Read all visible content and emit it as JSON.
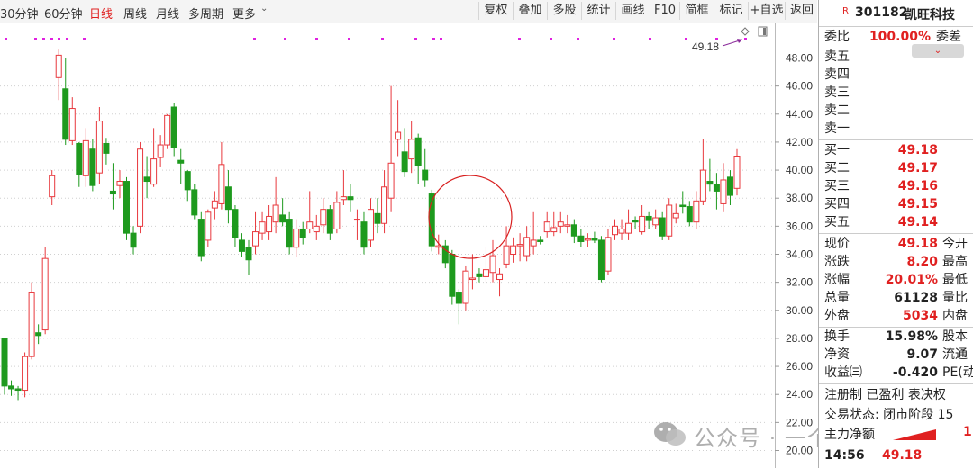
{
  "toolbar": {
    "periods": [
      "30分钟",
      "60分钟",
      "日线",
      "周线",
      "月线",
      "多周期",
      "更多"
    ],
    "active_period": "日线",
    "buttons": [
      "复权",
      "叠加",
      "多股",
      "统计",
      "画线",
      "F10",
      "简框",
      "标记",
      "+自选",
      "返回"
    ]
  },
  "chart_data": {
    "type": "candlestick",
    "y_ticks": [
      "48.00",
      "46.00",
      "44.00",
      "42.00",
      "40.00",
      "38.00",
      "36.00",
      "34.00",
      "32.00",
      "30.00",
      "28.00",
      "26.00",
      "24.00",
      "22.00",
      "20.00"
    ],
    "ylim": [
      19.5,
      49.5
    ],
    "up_color": "#e8383d",
    "down_color": "#1e9a1e",
    "last_price_marker": "49.18",
    "candles": [
      {
        "o": 28.0,
        "c": 24.6,
        "h": 28.0,
        "l": 24.0
      },
      {
        "o": 24.6,
        "c": 24.4,
        "h": 25.0,
        "l": 23.9
      },
      {
        "o": 24.4,
        "c": 24.3,
        "h": 24.6,
        "l": 23.6
      },
      {
        "o": 24.3,
        "c": 26.7,
        "h": 27.0,
        "l": 23.8
      },
      {
        "o": 26.7,
        "c": 31.3,
        "h": 32.0,
        "l": 26.5
      },
      {
        "o": 28.4,
        "c": 28.2,
        "h": 29.0,
        "l": 27.6
      },
      {
        "o": 28.6,
        "c": 33.7,
        "h": 34.5,
        "l": 28.3
      },
      {
        "o": 38.1,
        "c": 39.6,
        "h": 40.0,
        "l": 37.5
      },
      {
        "o": 46.6,
        "c": 48.2,
        "h": 48.6,
        "l": 45.0
      },
      {
        "o": 45.8,
        "c": 42.2,
        "h": 48.0,
        "l": 41.8
      },
      {
        "o": 42.1,
        "c": 44.4,
        "h": 45.2,
        "l": 41.8
      },
      {
        "o": 41.9,
        "c": 39.7,
        "h": 42.0,
        "l": 38.8
      },
      {
        "o": 39.6,
        "c": 42.1,
        "h": 43.0,
        "l": 38.8
      },
      {
        "o": 41.5,
        "c": 38.9,
        "h": 42.2,
        "l": 38.5
      },
      {
        "o": 39.8,
        "c": 43.5,
        "h": 44.5,
        "l": 39.0
      },
      {
        "o": 41.9,
        "c": 41.2,
        "h": 42.3,
        "l": 40.4
      },
      {
        "o": 38.5,
        "c": 38.3,
        "h": 40.5,
        "l": 37.2
      },
      {
        "o": 38.9,
        "c": 39.2,
        "h": 40.0,
        "l": 38.0
      },
      {
        "o": 39.2,
        "c": 35.5,
        "h": 39.5,
        "l": 35.0
      },
      {
        "o": 35.5,
        "c": 34.5,
        "h": 36.0,
        "l": 34.0
      },
      {
        "o": 36.0,
        "c": 41.5,
        "h": 42.0,
        "l": 35.5
      },
      {
        "o": 39.5,
        "c": 39.2,
        "h": 41.0,
        "l": 38.0
      },
      {
        "o": 39.0,
        "c": 40.8,
        "h": 43.0,
        "l": 38.8
      },
      {
        "o": 40.9,
        "c": 41.8,
        "h": 42.5,
        "l": 40.2
      },
      {
        "o": 41.8,
        "c": 43.9,
        "h": 44.0,
        "l": 41.5
      },
      {
        "o": 44.5,
        "c": 41.6,
        "h": 44.8,
        "l": 41.0
      },
      {
        "o": 40.7,
        "c": 40.5,
        "h": 41.5,
        "l": 39.0
      },
      {
        "o": 39.9,
        "c": 38.6,
        "h": 40.0,
        "l": 37.8
      },
      {
        "o": 38.6,
        "c": 36.8,
        "h": 39.0,
        "l": 36.5
      },
      {
        "o": 36.5,
        "c": 33.9,
        "h": 37.0,
        "l": 33.5
      },
      {
        "o": 35.0,
        "c": 37.0,
        "h": 37.2,
        "l": 34.5
      },
      {
        "o": 37.3,
        "c": 37.8,
        "h": 38.5,
        "l": 36.5
      },
      {
        "o": 37.6,
        "c": 40.4,
        "h": 42.0,
        "l": 37.2
      },
      {
        "o": 38.8,
        "c": 37.2,
        "h": 40.0,
        "l": 36.2
      },
      {
        "o": 37.2,
        "c": 35.2,
        "h": 37.5,
        "l": 34.5
      },
      {
        "o": 35.0,
        "c": 34.2,
        "h": 35.5,
        "l": 33.8
      },
      {
        "o": 34.5,
        "c": 33.6,
        "h": 35.0,
        "l": 32.5
      },
      {
        "o": 34.6,
        "c": 35.6,
        "h": 37.0,
        "l": 34.0
      },
      {
        "o": 35.5,
        "c": 36.3,
        "h": 37.0,
        "l": 35.0
      },
      {
        "o": 35.6,
        "c": 36.7,
        "h": 37.5,
        "l": 35.0
      },
      {
        "o": 36.3,
        "c": 37.5,
        "h": 39.5,
        "l": 35.5
      },
      {
        "o": 36.8,
        "c": 36.3,
        "h": 38.0,
        "l": 36.0
      },
      {
        "o": 36.5,
        "c": 34.5,
        "h": 37.0,
        "l": 34.0
      },
      {
        "o": 34.5,
        "c": 35.8,
        "h": 36.5,
        "l": 33.8
      },
      {
        "o": 35.8,
        "c": 35.2,
        "h": 36.3,
        "l": 34.7
      },
      {
        "o": 35.8,
        "c": 36.3,
        "h": 38.5,
        "l": 35.5
      },
      {
        "o": 35.6,
        "c": 36.0,
        "h": 36.8,
        "l": 35.0
      },
      {
        "o": 36.1,
        "c": 37.2,
        "h": 38.0,
        "l": 35.5
      },
      {
        "o": 37.2,
        "c": 35.5,
        "h": 37.5,
        "l": 35.0
      },
      {
        "o": 35.8,
        "c": 37.7,
        "h": 38.5,
        "l": 35.5
      },
      {
        "o": 37.9,
        "c": 38.1,
        "h": 40.0,
        "l": 37.5
      },
      {
        "o": 38.1,
        "c": 37.9,
        "h": 39.0,
        "l": 37.0
      },
      {
        "o": 36.5,
        "c": 36.5,
        "h": 37.2,
        "l": 35.0
      },
      {
        "o": 36.3,
        "c": 34.5,
        "h": 37.0,
        "l": 34.0
      },
      {
        "o": 35.0,
        "c": 37.2,
        "h": 38.0,
        "l": 34.5
      },
      {
        "o": 36.9,
        "c": 36.2,
        "h": 38.0,
        "l": 35.5
      },
      {
        "o": 36.2,
        "c": 38.8,
        "h": 40.0,
        "l": 35.5
      },
      {
        "o": 38.0,
        "c": 40.5,
        "h": 46.0,
        "l": 37.0
      },
      {
        "o": 42.2,
        "c": 42.7,
        "h": 45.0,
        "l": 41.0
      },
      {
        "o": 41.3,
        "c": 39.9,
        "h": 43.0,
        "l": 39.5
      },
      {
        "o": 40.8,
        "c": 42.2,
        "h": 43.5,
        "l": 39.8
      },
      {
        "o": 42.3,
        "c": 40.3,
        "h": 42.6,
        "l": 39.0
      },
      {
        "o": 40.0,
        "c": 39.3,
        "h": 41.5,
        "l": 38.8
      },
      {
        "o": 38.3,
        "c": 34.6,
        "h": 38.6,
        "l": 34.2
      },
      {
        "o": 34.5,
        "c": 34.6,
        "h": 35.4,
        "l": 34.0
      },
      {
        "o": 34.6,
        "c": 33.4,
        "h": 35.0,
        "l": 33.0
      },
      {
        "o": 34.0,
        "c": 31.0,
        "h": 34.3,
        "l": 30.4
      },
      {
        "o": 31.3,
        "c": 30.5,
        "h": 31.5,
        "l": 29.0
      },
      {
        "o": 30.5,
        "c": 32.8,
        "h": 33.2,
        "l": 30.0
      },
      {
        "o": 32.2,
        "c": 32.3,
        "h": 34.0,
        "l": 31.5
      },
      {
        "o": 32.6,
        "c": 32.4,
        "h": 33.0,
        "l": 32.0
      },
      {
        "o": 32.4,
        "c": 32.9,
        "h": 34.5,
        "l": 32.0
      },
      {
        "o": 32.7,
        "c": 33.9,
        "h": 35.0,
        "l": 32.0
      },
      {
        "o": 32.2,
        "c": 32.6,
        "h": 33.0,
        "l": 31.0
      },
      {
        "o": 33.3,
        "c": 34.6,
        "h": 36.0,
        "l": 33.0
      },
      {
        "o": 34.0,
        "c": 34.6,
        "h": 35.2,
        "l": 33.4
      },
      {
        "o": 34.6,
        "c": 34.7,
        "h": 35.5,
        "l": 33.5
      },
      {
        "o": 33.9,
        "c": 35.2,
        "h": 36.0,
        "l": 33.5
      },
      {
        "o": 34.6,
        "c": 35.0,
        "h": 37.0,
        "l": 34.0
      },
      {
        "o": 35.0,
        "c": 34.9,
        "h": 35.3,
        "l": 34.7
      },
      {
        "o": 35.6,
        "c": 36.3,
        "h": 37.0,
        "l": 35.2
      },
      {
        "o": 35.6,
        "c": 35.9,
        "h": 37.0,
        "l": 35.3
      },
      {
        "o": 36.0,
        "c": 36.3,
        "h": 37.0,
        "l": 35.5
      },
      {
        "o": 36.0,
        "c": 36.1,
        "h": 36.8,
        "l": 35.5
      },
      {
        "o": 36.1,
        "c": 35.3,
        "h": 36.5,
        "l": 34.8
      },
      {
        "o": 35.3,
        "c": 34.9,
        "h": 35.8,
        "l": 34.5
      },
      {
        "o": 35.0,
        "c": 35.1,
        "h": 35.5,
        "l": 34.5
      },
      {
        "o": 35.1,
        "c": 35.0,
        "h": 35.6,
        "l": 34.8
      },
      {
        "o": 35.0,
        "c": 32.2,
        "h": 35.3,
        "l": 32.0
      },
      {
        "o": 32.8,
        "c": 35.2,
        "h": 35.8,
        "l": 32.5
      },
      {
        "o": 35.4,
        "c": 36.0,
        "h": 36.5,
        "l": 35.0
      },
      {
        "o": 35.5,
        "c": 35.8,
        "h": 36.5,
        "l": 35.0
      },
      {
        "o": 35.5,
        "c": 36.2,
        "h": 37.2,
        "l": 35.0
      },
      {
        "o": 36.4,
        "c": 36.3,
        "h": 36.7,
        "l": 35.8
      },
      {
        "o": 35.6,
        "c": 36.7,
        "h": 37.5,
        "l": 35.4
      },
      {
        "o": 36.7,
        "c": 36.4,
        "h": 37.0,
        "l": 35.8
      },
      {
        "o": 36.1,
        "c": 36.6,
        "h": 37.2,
        "l": 35.8
      },
      {
        "o": 36.6,
        "c": 35.3,
        "h": 37.0,
        "l": 35.0
      },
      {
        "o": 35.3,
        "c": 37.5,
        "h": 38.0,
        "l": 35.0
      },
      {
        "o": 36.6,
        "c": 36.9,
        "h": 37.6,
        "l": 36.2
      },
      {
        "o": 37.5,
        "c": 37.4,
        "h": 38.5,
        "l": 36.9
      },
      {
        "o": 37.4,
        "c": 36.3,
        "h": 37.8,
        "l": 36.0
      },
      {
        "o": 36.3,
        "c": 37.8,
        "h": 38.5,
        "l": 35.8
      },
      {
        "o": 37.8,
        "c": 40.0,
        "h": 42.2,
        "l": 37.5
      },
      {
        "o": 39.2,
        "c": 39.0,
        "h": 40.8,
        "l": 38.5
      },
      {
        "o": 39.0,
        "c": 38.5,
        "h": 39.8,
        "l": 37.2
      },
      {
        "o": 37.6,
        "c": 39.3,
        "h": 40.5,
        "l": 37.0
      },
      {
        "o": 39.5,
        "c": 38.2,
        "h": 40.0,
        "l": 37.5
      },
      {
        "o": 38.7,
        "c": 41.0,
        "h": 41.5,
        "l": 38.2
      }
    ]
  },
  "annotations": {
    "price_label": "49.18"
  },
  "quote_panel": {
    "badge": "R",
    "code": "301182",
    "name": "凯旺科技",
    "weibi_label": "委比",
    "weibi_value": "100.00%",
    "weicha_label": "委差",
    "sell_labels": [
      "卖五",
      "卖四",
      "卖三",
      "卖二",
      "卖一"
    ],
    "buy": [
      {
        "label": "买一",
        "price": "49.18"
      },
      {
        "label": "买二",
        "price": "49.17"
      },
      {
        "label": "买三",
        "price": "49.16"
      },
      {
        "label": "买四",
        "price": "49.15"
      },
      {
        "label": "买五",
        "price": "49.14"
      }
    ],
    "stats": [
      {
        "label": "现价",
        "value": "49.18",
        "label2": "今开",
        "red": true
      },
      {
        "label": "涨跌",
        "value": "8.20",
        "label2": "最高",
        "red": true
      },
      {
        "label": "涨幅",
        "value": "20.01%",
        "label2": "最低",
        "red": true
      },
      {
        "label": "总量",
        "value": "61128",
        "label2": "量比",
        "red": false
      },
      {
        "label": "外盘",
        "value": "5034",
        "label2": "内盘",
        "red": true
      }
    ],
    "fin": [
      {
        "label": "换手",
        "value": "15.98%",
        "label2": "股本"
      },
      {
        "label": "净资",
        "value": "9.07",
        "label2": "流通"
      },
      {
        "label": "收益㈢",
        "value": "-0.420",
        "label2": "PE(动"
      }
    ],
    "info_line1": "注册制 已盈利 表决权",
    "info_line2": "交易状态: 闭市阶段 15",
    "flow_label": "主力净额",
    "flow_value": "1",
    "time": "14:56",
    "time_price": "49.18"
  },
  "watermark": {
    "text": "公众号 · 一个明白人"
  }
}
